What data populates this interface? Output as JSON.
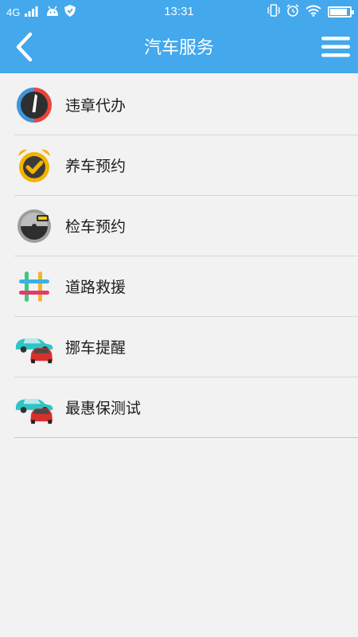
{
  "status_bar": {
    "network": "4G",
    "time": "13:31",
    "battery_level": 0.95,
    "icons": [
      "signal-icon",
      "android-icon",
      "shield-icon",
      "vibrate-icon",
      "alarm-icon",
      "wifi-icon",
      "battery-icon"
    ]
  },
  "header": {
    "title": "汽车服务",
    "back_icon": "back-arrow-icon",
    "menu_icon": "hamburger-menu-icon",
    "background": "#43a8ec"
  },
  "menu": {
    "items": [
      {
        "label": "违章代办",
        "icon": "speedometer-icon"
      },
      {
        "label": "养车预约",
        "icon": "alarm-clock-check-icon"
      },
      {
        "label": "检车预约",
        "icon": "clock-car-icon"
      },
      {
        "label": "道路救援",
        "icon": "hashtag-icon"
      },
      {
        "label": "挪车提醒",
        "icon": "cars-icon"
      },
      {
        "label": "最惠保测试",
        "icon": "cars-icon"
      }
    ]
  }
}
